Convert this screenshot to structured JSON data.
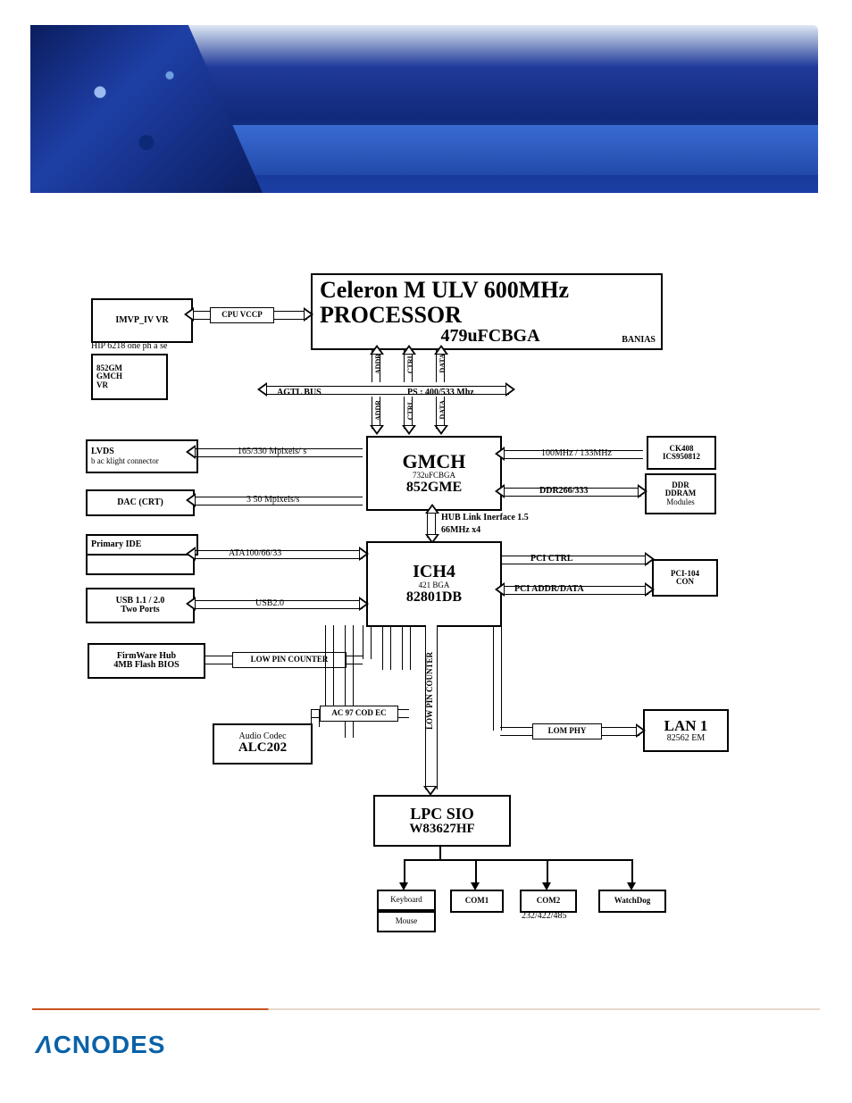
{
  "header": {
    "brand": "ACNODES"
  },
  "diagram": {
    "processor": {
      "line1": "Celeron M ULV 600MHz",
      "line2": "PROCESSOR",
      "line3": "479uFCBGA",
      "side_note": "BANIAS"
    },
    "imvp": {
      "line1": "IMVP_IV VR",
      "line2": "HIP 6218 one ph a se"
    },
    "cpu_vccp_label": "CPU  VCCP",
    "gmch_vr": {
      "l1": "852GM",
      "l2": "GMCH",
      "l3": "VR"
    },
    "fsb_bus": {
      "left": "AGTL  BUS",
      "right": "PS : 400/533 Mhz",
      "mini": [
        "ADDR",
        "CTRL",
        "DATA"
      ]
    },
    "gmch": {
      "l1": "GMCH",
      "l2": "732uFCBGA",
      "l3": "852GME"
    },
    "lvds": {
      "l1": "LVDS",
      "l2": "b ac klight connector"
    },
    "lvds_rate": "165/330 Mpixels/ s",
    "dac": "DAC (CRT)",
    "dac_rate": "3 50      Mpixels/s",
    "primary_ide": "Primary  IDE",
    "empty_box": "",
    "ata_label": "ATA100/66/33",
    "usb": {
      "l1": "USB  1.1 / 2.0",
      "l2": "Two  Ports"
    },
    "usb_label": "USB2.0",
    "fwh": {
      "l1": "FirmWare Hub",
      "l2": "4MB  Flash BIOS"
    },
    "lpc_label": "LOW PIN COUNTER",
    "hub_link": {
      "l1": "HUB Link Inerface 1.5",
      "l2": "66MHz x4"
    },
    "ich": {
      "l1": "ICH4",
      "l2": "421 BGA",
      "l3": "82801DB"
    },
    "ck408": {
      "l1": "CK408",
      "l2": "ICS950812"
    },
    "clock_rate": "100MHz / 133MHz",
    "ddr_label": "DDR266/333",
    "ddr_box": {
      "l1": "DDR",
      "l2": "DDRAM",
      "l3": "Modules"
    },
    "pci_ctrl": "PCI CTRL",
    "pci_addr": "PCI ADDR/DATA",
    "pci104": {
      "l1": "PCI-104",
      "l2": "CON"
    },
    "ac97": "AC 97 COD EC",
    "audio": {
      "l1": "Audio  Codec",
      "l2": "ALC202"
    },
    "lpc_vertical": "LOW PIN COUNTER",
    "lan": {
      "l1": "LAN 1",
      "l2": "82562 EM"
    },
    "lom": "LOM  PHY",
    "lpc_sio": {
      "l1": "LPC  SIO",
      "l2": "W83627HF"
    },
    "io": {
      "kb": "Keyboard",
      "mouse": "Mouse",
      "com1": "COM1",
      "com2": "COM2",
      "com2b": "232/422/485",
      "wd": "WatchDog"
    }
  }
}
